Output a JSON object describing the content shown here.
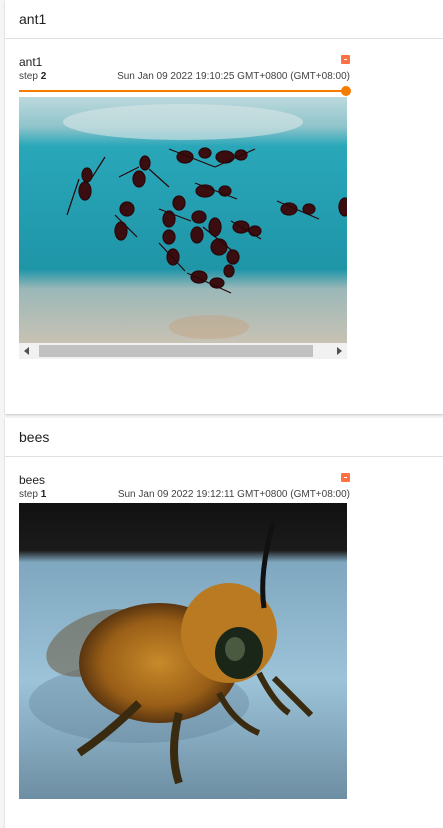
{
  "sections": [
    {
      "title": "ant1",
      "card": {
        "name": "ant1",
        "step_prefix": "step ",
        "step_value": "2",
        "timestamp": "Sun Jan 09 2022 19:10:25 GMT+0800 (GMT+08:00)",
        "slider_fraction": 1.0,
        "image_icon": "ant-image"
      }
    },
    {
      "title": "bees",
      "card": {
        "name": "bees",
        "step_prefix": "step ",
        "step_value": "1",
        "timestamp": "Sun Jan 09 2022 19:12:11 GMT+0800 (GMT+08:00)",
        "image_icon": "bee-image"
      }
    }
  ],
  "colors": {
    "accent": "#f57c00",
    "pin": "#ff7043",
    "ant_bg": "#1fa3b5",
    "bee_bg": "#8fb7cf"
  }
}
